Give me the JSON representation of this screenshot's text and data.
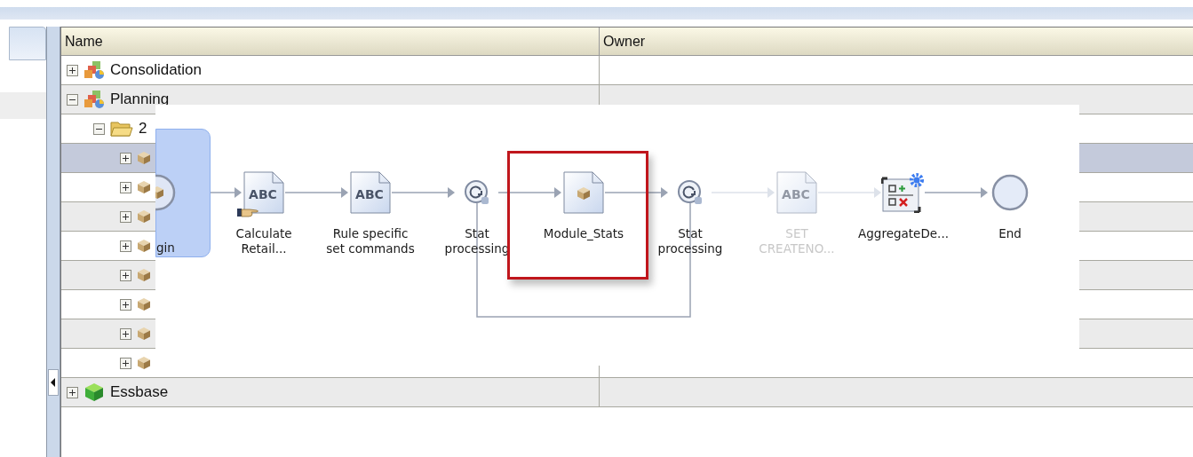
{
  "tree_table": {
    "columns": [
      "Name",
      "Owner"
    ],
    "rows": [
      {
        "name": "Consolidation",
        "kind": "application",
        "expanded": false,
        "selected": false
      },
      {
        "name": "Planning",
        "kind": "application",
        "expanded": true,
        "selected": false,
        "children": [
          {
            "name": "2",
            "kind": "folder",
            "expanded": true,
            "selected": false,
            "children": [
              {
                "kind": "rule",
                "expanded": false,
                "selected": true
              },
              {
                "kind": "rule",
                "expanded": false,
                "selected": false
              },
              {
                "kind": "rule",
                "expanded": false,
                "selected": false
              },
              {
                "kind": "rule",
                "expanded": false,
                "selected": false
              },
              {
                "kind": "rule",
                "expanded": false,
                "selected": false
              },
              {
                "kind": "rule",
                "expanded": false,
                "selected": false
              },
              {
                "kind": "rule",
                "expanded": false,
                "selected": false
              },
              {
                "kind": "rule",
                "expanded": false,
                "selected": false
              }
            ]
          }
        ]
      },
      {
        "name": "Essbase",
        "kind": "database",
        "expanded": false,
        "selected": false
      }
    ]
  },
  "flow_diagram": {
    "nodes": [
      {
        "kind": "start",
        "label": [
          "gin"
        ],
        "selected": true,
        "disabled": false,
        "highlighted": false,
        "hand": false
      },
      {
        "kind": "script",
        "icon_text": "ABC",
        "label": [
          "Calculate",
          "Retail..."
        ],
        "selected": false,
        "disabled": false,
        "highlighted": false,
        "hand": true
      },
      {
        "kind": "script",
        "icon_text": "ABC",
        "label": [
          "Rule specific",
          "set commands"
        ],
        "selected": false,
        "disabled": false,
        "highlighted": false,
        "hand": false
      },
      {
        "kind": "loop",
        "label": [
          "Stat",
          "processing"
        ],
        "selected": false,
        "disabled": false,
        "highlighted": false,
        "hand": false
      },
      {
        "kind": "module",
        "label": [
          "Module_Stats"
        ],
        "selected": false,
        "disabled": false,
        "highlighted": true,
        "hand": false
      },
      {
        "kind": "loop",
        "label": [
          "Stat",
          "processing"
        ],
        "selected": false,
        "disabled": false,
        "highlighted": false,
        "hand": false
      },
      {
        "kind": "script",
        "icon_text": "ABC",
        "label": [
          "SET",
          "CREATENO..."
        ],
        "selected": false,
        "disabled": true,
        "highlighted": false,
        "hand": false
      },
      {
        "kind": "aggregate",
        "label": [
          "AggregateDe..."
        ],
        "selected": false,
        "disabled": false,
        "highlighted": false,
        "hand": false
      },
      {
        "kind": "end",
        "label": [
          "End"
        ],
        "selected": false,
        "disabled": false,
        "highlighted": false,
        "hand": false
      }
    ]
  }
}
